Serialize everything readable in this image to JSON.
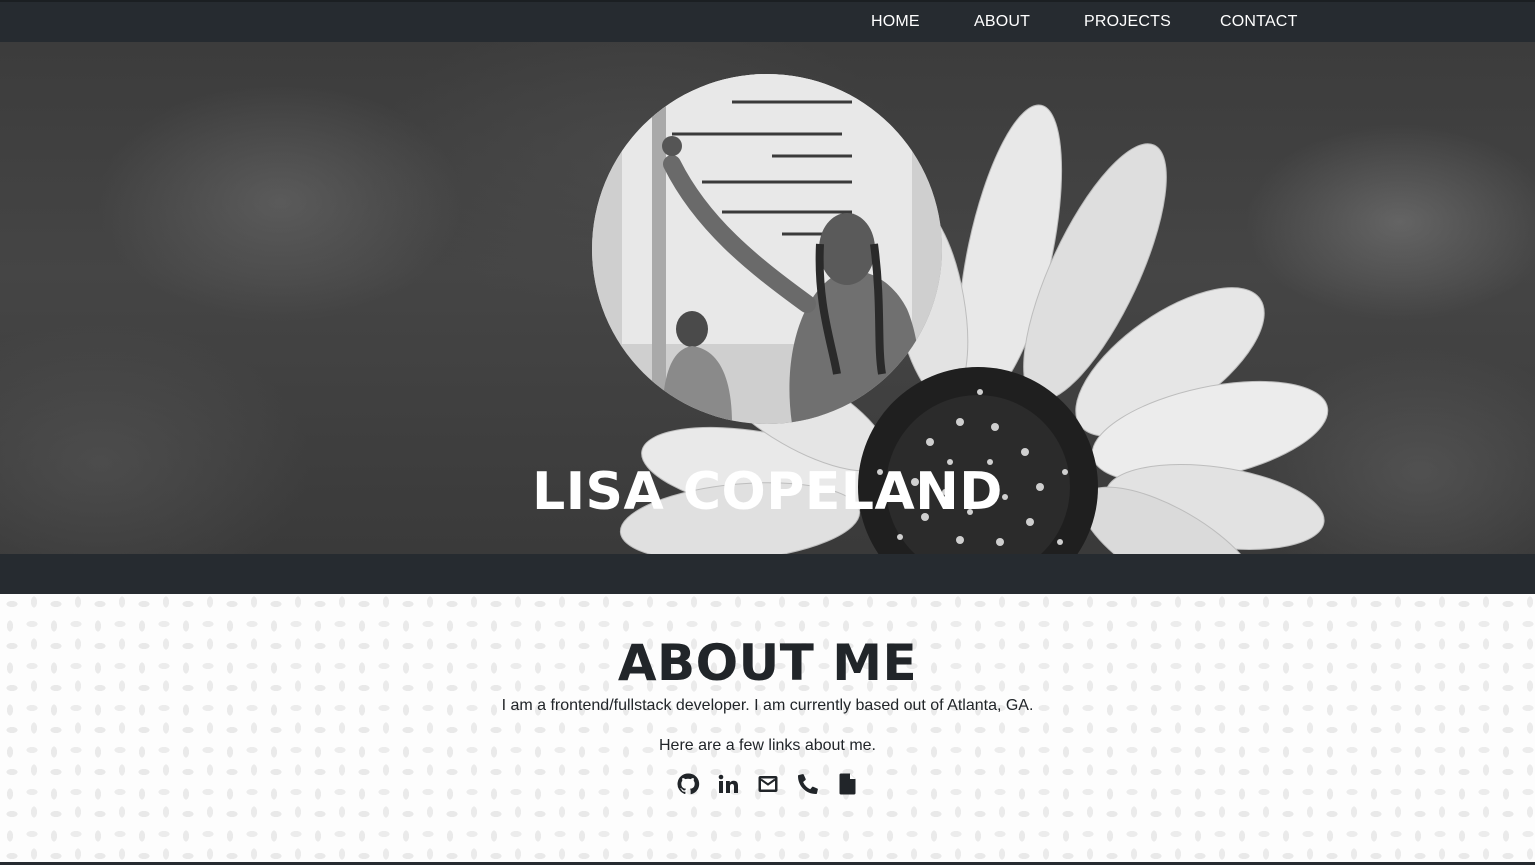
{
  "nav": {
    "items": [
      {
        "label": "HOME"
      },
      {
        "label": "ABOUT"
      },
      {
        "label": "PROJECTS"
      },
      {
        "label": "CONTACT"
      }
    ]
  },
  "hero": {
    "name": "LISA COPELAND"
  },
  "about": {
    "title": "ABOUT ME",
    "intro": "I am a frontend/fullstack developer. I am currently based out of Atlanta, GA.",
    "links_text": "Here are a few links about me.",
    "links": [
      {
        "icon": "github-icon"
      },
      {
        "icon": "linkedin-icon"
      },
      {
        "icon": "email-icon"
      },
      {
        "icon": "phone-icon"
      },
      {
        "icon": "resume-file-icon"
      }
    ]
  },
  "colors": {
    "nav_background": "#262b30",
    "text_dark": "#212529",
    "hero_text": "#ffffff"
  }
}
